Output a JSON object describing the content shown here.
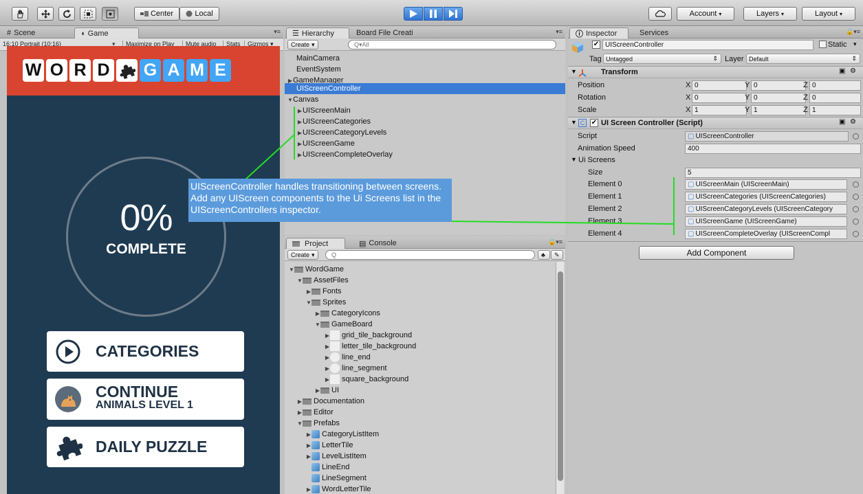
{
  "toolbar": {
    "pivot_label": "Center",
    "space_label": "Local",
    "account_label": "Account",
    "layers_label": "Layers",
    "layout_label": "Layout"
  },
  "scene_tab": "Scene",
  "game_tab": "Game",
  "game_toolbar": {
    "aspect": "16:10 Portrait (10:16)",
    "maximize": "Maximize on Play",
    "mute": "Mute audio",
    "stats": "Stats",
    "gizmos": "Gizmos"
  },
  "game": {
    "title_letters": [
      "W",
      "O",
      "R",
      "D",
      "G",
      "A",
      "M",
      "E"
    ],
    "percent": "0%",
    "complete": "COMPLETE",
    "categories": "CATEGORIES",
    "continue": "CONTINUE",
    "continue_sub": "ANIMALS LEVEL 1",
    "daily": "DAILY PUZZLE"
  },
  "hierarchy": {
    "tab": "Hierarchy",
    "tab2": "Board File Creati",
    "create": "Create",
    "search_placeholder": "Q▾All",
    "items": [
      {
        "label": "MainCamera"
      },
      {
        "label": "EventSystem"
      },
      {
        "label": "GameManager"
      },
      {
        "label": "UIScreenController"
      },
      {
        "label": "Canvas"
      },
      {
        "label": "UIScreenMain"
      },
      {
        "label": "UIScreenCategories"
      },
      {
        "label": "UIScreenCategoryLevels"
      },
      {
        "label": "UIScreenGame"
      },
      {
        "label": "UIScreenCompleteOverlay"
      }
    ]
  },
  "project": {
    "tab": "Project",
    "tab2": "Console",
    "create": "Create",
    "search_placeholder": "Q",
    "items": [
      {
        "label": "WordGame"
      },
      {
        "label": "AssetFiles"
      },
      {
        "label": "Fonts"
      },
      {
        "label": "Sprites"
      },
      {
        "label": "CategoryIcons"
      },
      {
        "label": "GameBoard"
      },
      {
        "label": "grid_tile_background"
      },
      {
        "label": "letter_tile_background"
      },
      {
        "label": "line_end"
      },
      {
        "label": "line_segment"
      },
      {
        "label": "square_background"
      },
      {
        "label": "UI"
      },
      {
        "label": "Documentation"
      },
      {
        "label": "Editor"
      },
      {
        "label": "Prefabs"
      },
      {
        "label": "CategoryListItem"
      },
      {
        "label": "LetterTile"
      },
      {
        "label": "LevelListItem"
      },
      {
        "label": "LineEnd"
      },
      {
        "label": "LineSegment"
      },
      {
        "label": "WordLetterTile"
      }
    ]
  },
  "inspector": {
    "tab": "Inspector",
    "tab2": "Services",
    "object_name": "UIScreenController",
    "static_label": "Static",
    "tag_label": "Tag",
    "tag_value": "Untagged",
    "layer_label": "Layer",
    "layer_value": "Default",
    "transform": {
      "title": "Transform",
      "position_label": "Position",
      "rotation_label": "Rotation",
      "scale_label": "Scale",
      "position": [
        "0",
        "0",
        "0"
      ],
      "rotation": [
        "0",
        "0",
        "0"
      ],
      "scale": [
        "1",
        "1",
        "1"
      ],
      "axes": [
        "X",
        "Y",
        "Z"
      ]
    },
    "script_component": {
      "title": "UI Screen Controller (Script)",
      "script_label": "Script",
      "script_value": "UIScreenController",
      "anim_label": "Animation Speed",
      "anim_value": "400",
      "ui_screens_label": "Ui Screens",
      "size_label": "Size",
      "size_value": "5",
      "elements": [
        {
          "label": "Element 0",
          "value": "UIScreenMain (UIScreenMain)"
        },
        {
          "label": "Element 1",
          "value": "UIScreenCategories (UIScreenCategories)"
        },
        {
          "label": "Element 2",
          "value": "UIScreenCategoryLevels (UIScreenCategory"
        },
        {
          "label": "Element 3",
          "value": "UIScreenGame (UIScreenGame)"
        },
        {
          "label": "Element 4",
          "value": "UIScreenCompleteOverlay (UIScreenCompl"
        }
      ]
    },
    "add_component": "Add Component"
  },
  "annotation": "UIScreenController handles transitioning between screens. Add any UIScreen components to the Ui Screens list in the UIScreenControllers inspector.",
  "colors": {
    "game_bg": "#1f3b52",
    "game_top": "#d8442f",
    "selected_row": "#3a7bd5",
    "annotation_bg": "#5b9bdc",
    "annotation_line": "#22dd22"
  }
}
